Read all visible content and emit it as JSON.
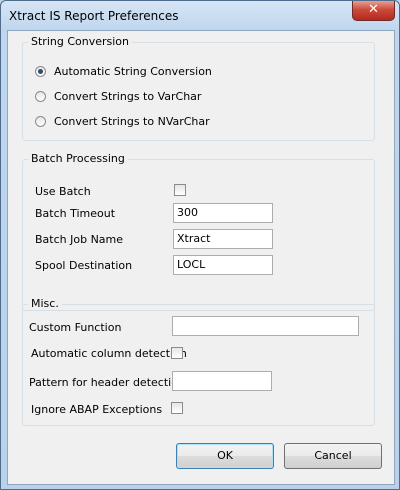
{
  "window": {
    "title": "Xtract IS Report Preferences",
    "close_glyph": "✕"
  },
  "string_conversion": {
    "title": "String Conversion",
    "options": [
      {
        "label": "Automatic String Conversion",
        "checked": true
      },
      {
        "label": "Convert Strings to VarChar",
        "checked": false
      },
      {
        "label": "Convert Strings to NVarChar",
        "checked": false
      }
    ]
  },
  "batch_processing": {
    "title": "Batch Processing",
    "use_batch_label": "Use Batch",
    "use_batch_checked": false,
    "timeout_label": "Batch Timeout",
    "timeout_value": "300",
    "job_name_label": "Batch Job Name",
    "job_name_value": "Xtract",
    "spool_label": "Spool Destination",
    "spool_value": "LOCL"
  },
  "misc": {
    "title": "Misc.",
    "custom_function_label": "Custom Function",
    "custom_function_value": "",
    "auto_column_label": "Automatic column detection",
    "auto_column_checked": false,
    "header_pattern_label": "Pattern for header detection",
    "header_pattern_value": "",
    "ignore_abap_label": "Ignore ABAP Exceptions",
    "ignore_abap_checked": false
  },
  "buttons": {
    "ok": "OK",
    "cancel": "Cancel"
  }
}
